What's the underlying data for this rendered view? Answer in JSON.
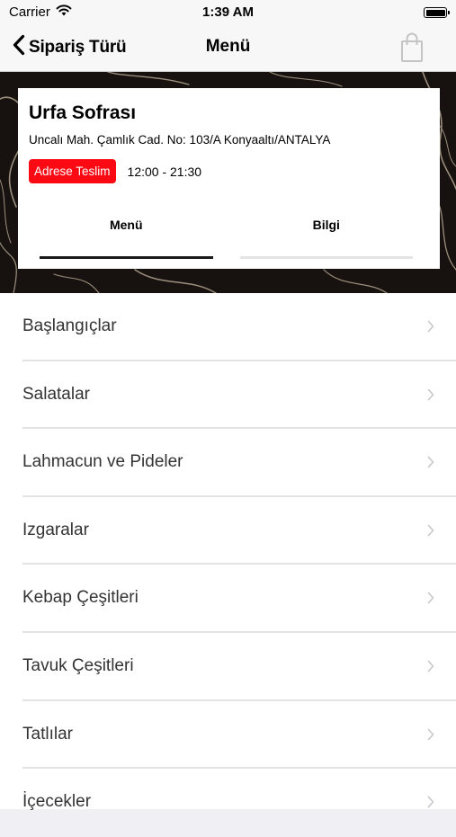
{
  "status_bar": {
    "carrier": "Carrier",
    "time": "1:39 AM"
  },
  "nav": {
    "back_label": "Sipariş Türü",
    "title": "Menü"
  },
  "restaurant": {
    "name": "Urfa Sofrası",
    "address": "Uncalı Mah. Çamlık Cad. No: 103/A Konyaaltı/ANTALYA",
    "delivery_badge": "Adrese Teslim",
    "hours": "12:00 - 21:30"
  },
  "tabs": [
    {
      "label": "Menü",
      "active": true
    },
    {
      "label": "Bilgi",
      "active": false
    }
  ],
  "categories": [
    {
      "label": "Başlangıçlar"
    },
    {
      "label": "Salatalar"
    },
    {
      "label": "Lahmacun ve Pideler"
    },
    {
      "label": "Izgaralar"
    },
    {
      "label": "Kebap Çeşitleri"
    },
    {
      "label": "Tavuk Çeşitleri"
    },
    {
      "label": "Tatlılar"
    },
    {
      "label": "İçecekler"
    }
  ],
  "colors": {
    "accent": "#fb0a13",
    "nav_bg": "#f7f7f7",
    "hero_bg": "#17120f"
  },
  "icons": {
    "back": "chevron-left-icon",
    "bag": "shopping-bag-icon",
    "wifi": "wifi-icon",
    "battery": "battery-icon",
    "row": "chevron-right-icon"
  }
}
